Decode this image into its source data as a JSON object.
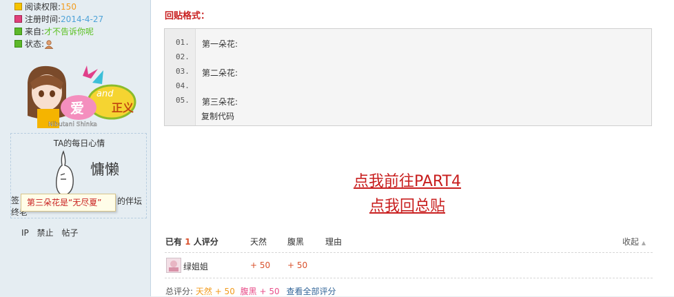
{
  "profile": {
    "read_label": "阅读权限:",
    "read_value": "150",
    "reg_label": "注册时间:",
    "reg_value": "2014-4-27",
    "from_label": "来自:",
    "from_value": "才不告诉你呢",
    "state_label": "状态:",
    "avatar_text": "Nibutani Shinka",
    "avatar_caption_left": "爱",
    "avatar_caption_mid": "and",
    "avatar_caption_right": "正义",
    "mood_title": "TA的每日心情",
    "mood_value": "慵懒",
    "signature_left_1": "签",
    "signature_left_2": "终老",
    "signature_right": "的伴坛",
    "tooltip": "第三朵花是“无尽夏”",
    "actions": [
      "IP",
      "禁止",
      "帖子"
    ]
  },
  "post": {
    "section_title": "回贴格式：",
    "code_lines": [
      {
        "no": "01.",
        "text": "第一朵花:"
      },
      {
        "no": "02.",
        "text": ""
      },
      {
        "no": "03.",
        "text": "第二朵花:"
      },
      {
        "no": "04.",
        "text": ""
      },
      {
        "no": "05.",
        "text": "第三朵花:"
      }
    ],
    "copy_label": "复制代码",
    "link_part4": "点我前往PART4",
    "link_back": "点我回总贴"
  },
  "rating": {
    "header_prefix": "已有",
    "count": "1",
    "header_suffix": "人评分",
    "col1": "天然",
    "col2": "腹黑",
    "col3": "理由",
    "collapse": "收起",
    "rows": [
      {
        "user": "绿姐姐",
        "v1": "+ 50",
        "v2": "+ 50"
      }
    ],
    "total_label": "总评分:",
    "total_1": "天然 + 50",
    "total_2": "腹黑 + 50",
    "view_all": "查看全部评分"
  },
  "colors": {
    "accent_red": "#c81e1e",
    "value_orange": "#f29b1c",
    "value_green": "#5ac020"
  }
}
